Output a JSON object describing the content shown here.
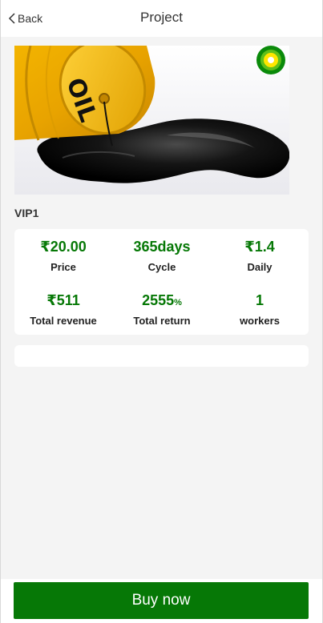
{
  "header": {
    "back_label": "Back",
    "title": "Project"
  },
  "hero": {
    "barrel_text": "OIL",
    "logo_icon": "bp-helios-logo"
  },
  "product": {
    "name": "VIP1"
  },
  "stats": {
    "price": {
      "value": "₹20.00",
      "label": "Price"
    },
    "cycle": {
      "value": "365days",
      "label": "Cycle"
    },
    "daily": {
      "value": "₹1.4",
      "label": "Daily"
    },
    "total_revenue": {
      "value": "₹511",
      "label": "Total revenue"
    },
    "total_return": {
      "value": "2555",
      "unit": "%",
      "label": "Total return"
    },
    "workers": {
      "value": "1",
      "label": "workers"
    }
  },
  "colors": {
    "accent": "#067806",
    "background": "#f4f4f4",
    "card": "#ffffff"
  },
  "footer": {
    "buy_label": "Buy now"
  }
}
